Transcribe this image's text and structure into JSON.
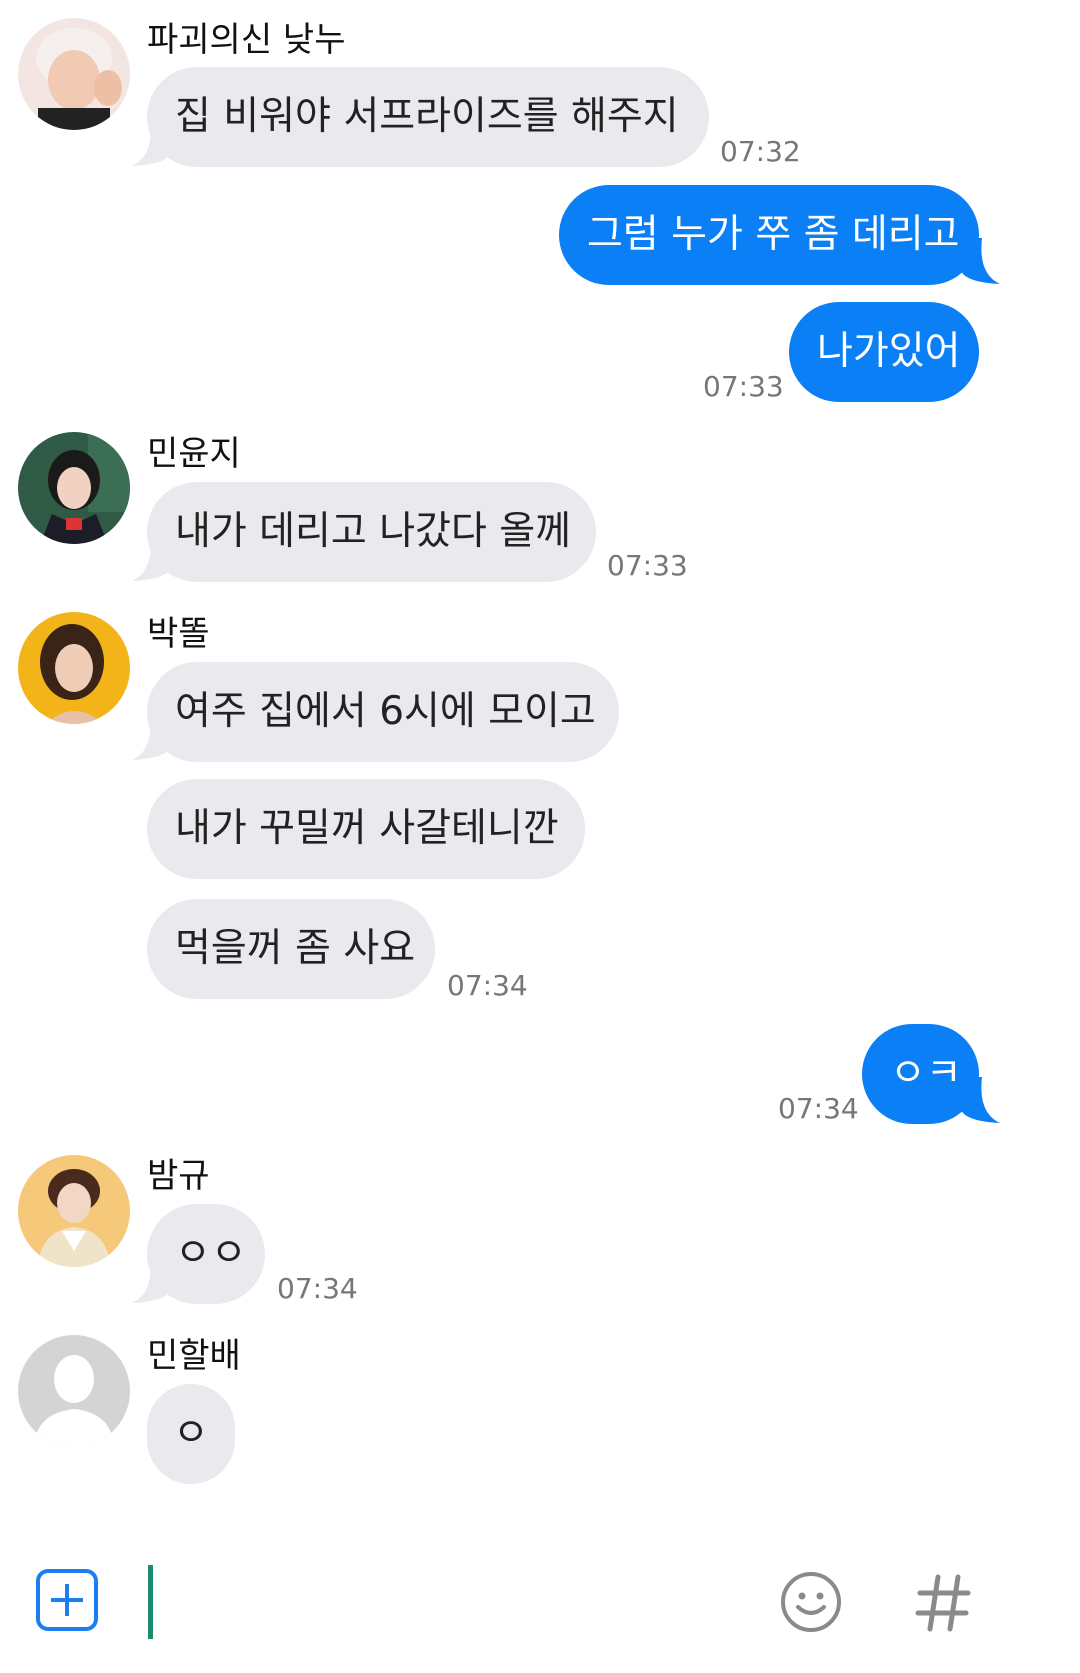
{
  "colors": {
    "incoming": "#e9e9ee",
    "outgoing": "#0b7ff6",
    "cursor": "#1e8a6e",
    "accent_button": "#1a7ef2"
  },
  "messages": {
    "m1": {
      "sender": "파괴의신 낮누",
      "text": "집 비워야 서프라이즈를 해주지",
      "time": "07:32"
    },
    "m2": {
      "text": "그럼 누가 쭈 좀 데리고"
    },
    "m3": {
      "text": "나가있어",
      "time": "07:33"
    },
    "m4": {
      "sender": "민윤지",
      "text": "내가 데리고 나갔다 올께",
      "time": "07:33"
    },
    "m5": {
      "sender": "박똘",
      "text": "여주 집에서 6시에 모이고"
    },
    "m6": {
      "text": "내가 꾸밀꺼 사갈테니깐"
    },
    "m7": {
      "text": "먹을꺼 좀 사요",
      "time": "07:34"
    },
    "m8": {
      "text": "ㅇㅋ",
      "time": "07:34"
    },
    "m9": {
      "sender": "밤규",
      "text": "ㅇㅇ",
      "time": "07:34"
    },
    "m10": {
      "sender": "민할배",
      "text": "ㅇ"
    }
  },
  "input_bar": {
    "add_icon": "plus-square-icon",
    "emoji_icon": "smiley-icon",
    "hashtag_icon": "hashtag-icon"
  }
}
